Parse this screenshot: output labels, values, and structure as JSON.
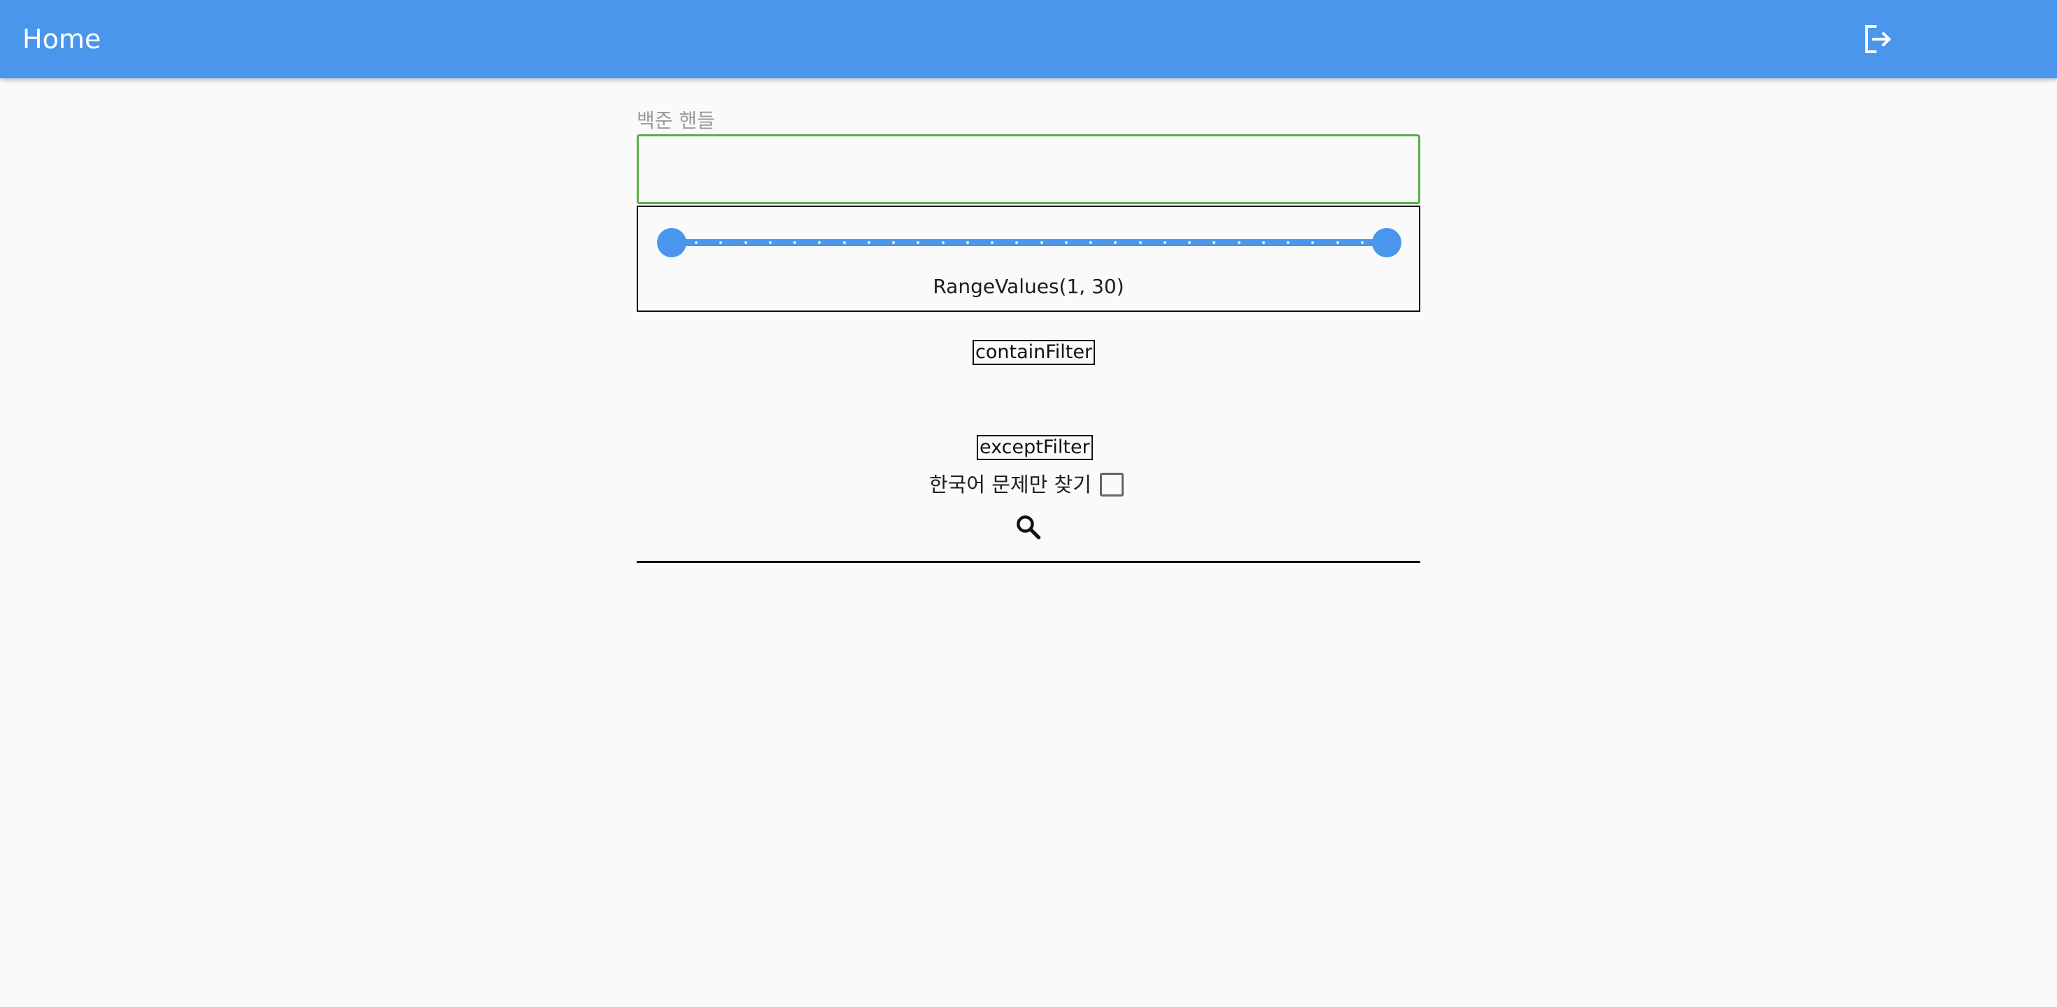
{
  "app_bar": {
    "title": "Home",
    "action_icon": "logout-icon",
    "background_color": "#4a96ec"
  },
  "form": {
    "handle_field": {
      "label": "백준 핸들",
      "value": "",
      "border_color": "#5aad4a"
    },
    "level_slider": {
      "min": 1,
      "max": 30,
      "start": 1,
      "end": 30,
      "divisions": 29,
      "range_text": "RangeValues(1, 30)",
      "accent_color": "#4a96ec"
    },
    "contain_filter_label": "containFilter",
    "except_filter_label": "exceptFilter",
    "korean_only": {
      "label": "한국어 문제만 찾기",
      "checked": false
    },
    "search_icon": "search-icon"
  }
}
